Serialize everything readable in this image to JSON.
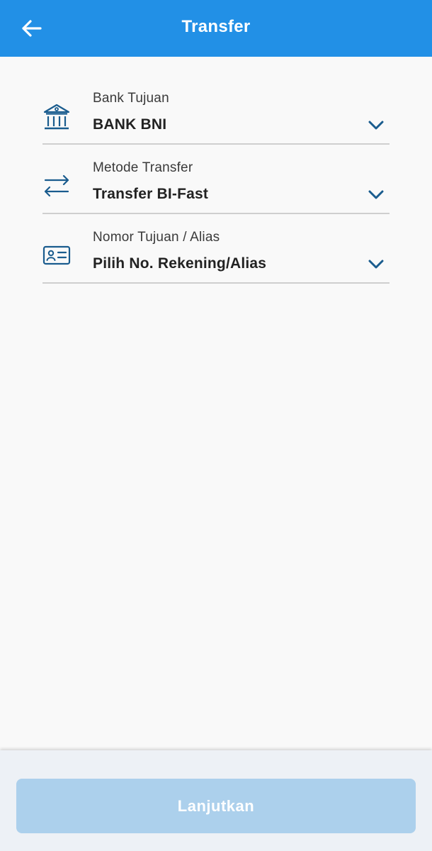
{
  "header": {
    "title": "Transfer",
    "back_icon": "arrow-left-icon"
  },
  "form": {
    "fields": [
      {
        "label": "Bank Tujuan",
        "value": "BANK BNI",
        "icon": "bank-icon"
      },
      {
        "label": "Metode Transfer",
        "value": "Transfer BI-Fast",
        "icon": "transfer-arrows-icon"
      },
      {
        "label": "Nomor Tujuan / Alias",
        "value": "Pilih No. Rekening/Alias",
        "icon": "id-card-icon"
      }
    ]
  },
  "footer": {
    "continue_label": "Lanjutkan",
    "continue_enabled": false
  },
  "colors": {
    "primary": "#2290e6",
    "icon": "#1a5c8e",
    "button_disabled": "#acd0ec"
  }
}
